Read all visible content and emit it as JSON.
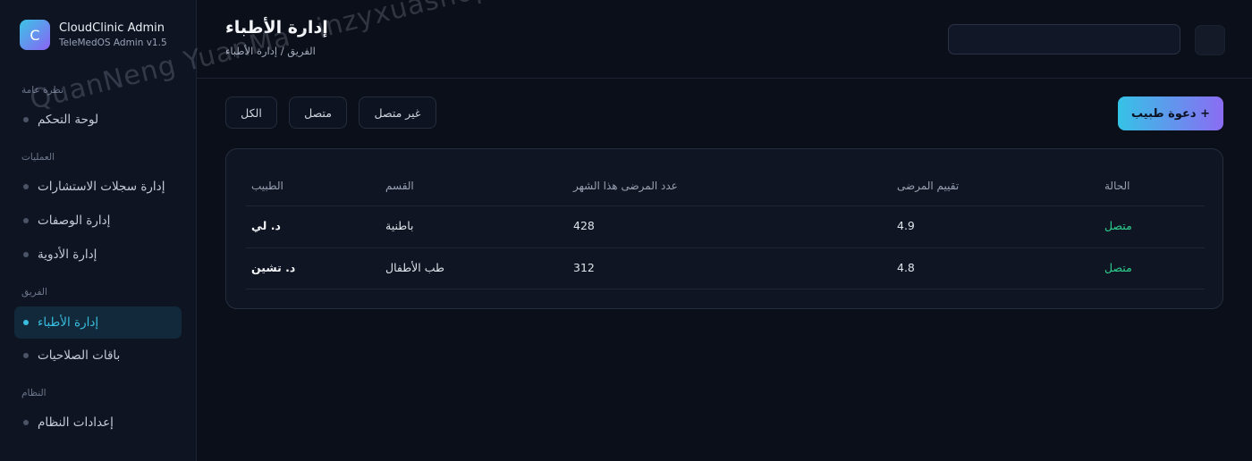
{
  "brand": {
    "logo_letter": "C",
    "title": "CloudClinic Admin",
    "subtitle": "TeleMedOS Admin v1.5"
  },
  "sidebar": {
    "sections": [
      {
        "label": "نظرة عامة"
      },
      {
        "label": "العمليات"
      },
      {
        "label": "الفريق"
      },
      {
        "label": "النظام"
      }
    ],
    "items": [
      {
        "label": "لوحة التحكم"
      },
      {
        "label": "إدارة سجلات الاستشارات"
      },
      {
        "label": "إدارة الوصفات"
      },
      {
        "label": "إدارة الأدوية"
      },
      {
        "label": "إدارة الأطباء",
        "active": true
      },
      {
        "label": "باقات الصلاحيات"
      },
      {
        "label": "إعدادات النظام"
      }
    ]
  },
  "header": {
    "title": "إدارة الأطباء",
    "breadcrumb": "الفريق / إدارة الأطباء"
  },
  "toolbar": {
    "invite_label": "دعوة طبيب +",
    "filters": [
      "الكل",
      "متصل",
      "غير متصل"
    ]
  },
  "table": {
    "columns": [
      "الطبيب",
      "القسم",
      "عدد المرضى هذا الشهر",
      "تقييم المرضى",
      "الحالة"
    ],
    "rows": [
      {
        "doctor": "د. لي",
        "department": "باطنية",
        "patients": "428",
        "rating": "4.9",
        "status": "متصل"
      },
      {
        "doctor": "د. تشين",
        "department": "طب الأطفال",
        "patients": "312",
        "rating": "4.8",
        "status": "متصل"
      }
    ]
  },
  "watermark": "QuanNeng YuanMa · inzyxuashop.com",
  "colors": {
    "accent": "#39bfe0",
    "accent_gradient_end": "#8b6cf3",
    "status_online": "#2ecf8f",
    "background": "#0b0f19"
  }
}
